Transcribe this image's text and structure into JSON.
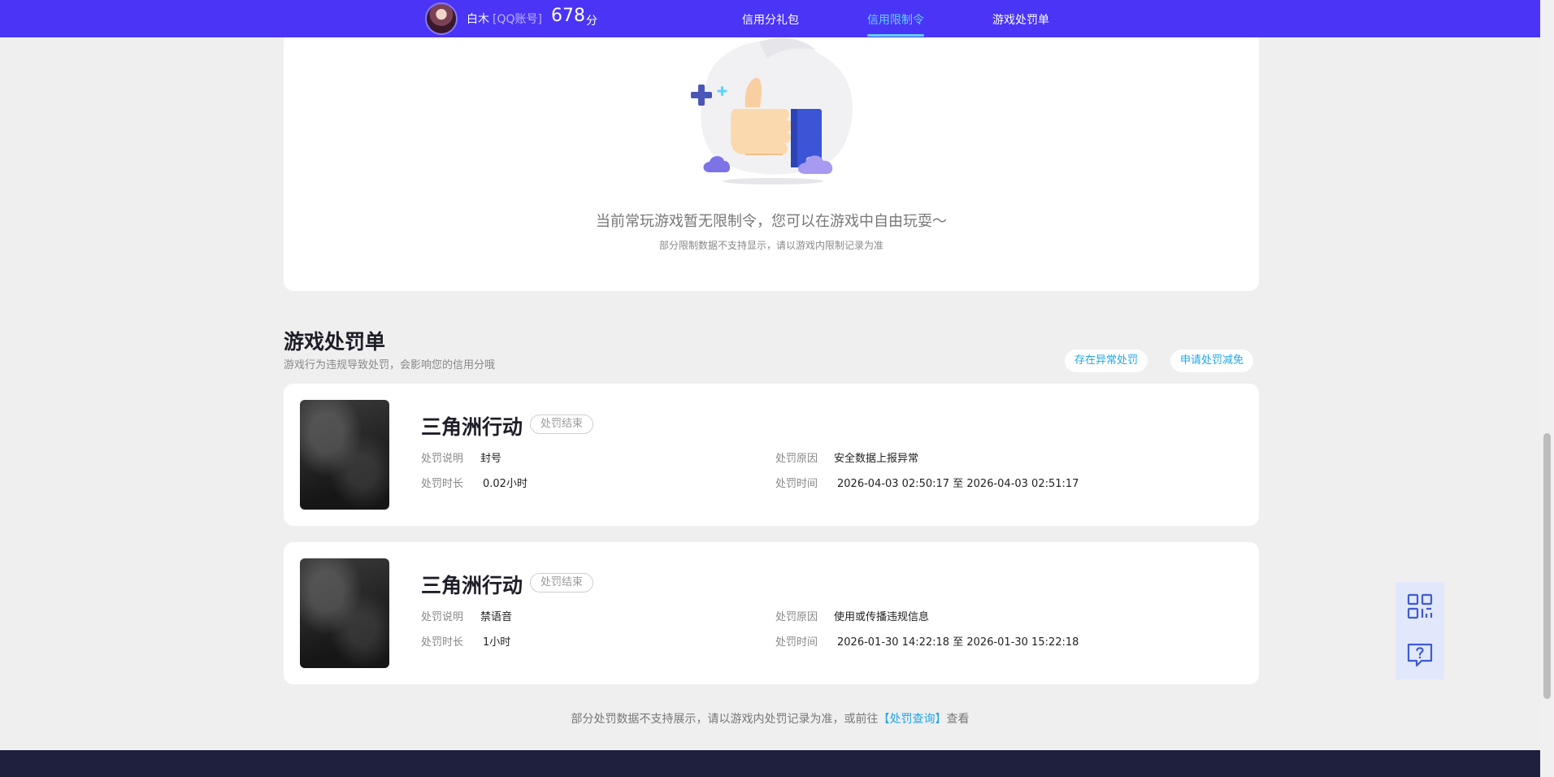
{
  "topbar": {
    "username": "白木",
    "account_type": "[QQ账号]",
    "score": "678",
    "score_unit": "分",
    "nav": [
      {
        "label": "信用分礼包"
      },
      {
        "label": "信用限制令"
      },
      {
        "label": "游戏处罚单"
      }
    ],
    "active_nav": "信用限制令"
  },
  "status": {
    "main": "当前常玩游戏暂无限制令，您可以在游戏中自由玩耍～",
    "sub": "部分限制数据不支持显示，请以游戏内限制记录为准"
  },
  "penalty_section": {
    "title": "游戏处罚单",
    "desc": "游戏行为违规导致处罚，会影响您的信用分哦",
    "btn_abnormal": "存在异常处罚",
    "btn_reduce": "申请处罚减免"
  },
  "labels": {
    "desc": "处罚说明",
    "duration": "处罚时长",
    "reason": "处罚原因",
    "time": "处罚时间",
    "time_sep": "至"
  },
  "records": [
    {
      "game": "三角洲行动",
      "status": "处罚结束",
      "desc": "封号",
      "duration": "0.02小时",
      "reason": "安全数据上报异常",
      "start": "2026-04-03 02:50:17",
      "end": "2026-04-03 02:51:17"
    },
    {
      "game": "三角洲行动",
      "status": "处罚结束",
      "desc": "禁语音",
      "duration": "1小时",
      "reason": "使用或传播违规信息",
      "start": "2026-01-30 14:22:18",
      "end": "2026-01-30 15:22:18"
    }
  ],
  "footer": {
    "before": "部分处罚数据不支持展示，请以游戏内处罚记录为准，或前往",
    "link": "【处罚查询】",
    "after": "查看"
  },
  "colors": {
    "topbar": "#4a34f5",
    "active": "#5fd3ff",
    "link": "#1fa6e8"
  }
}
